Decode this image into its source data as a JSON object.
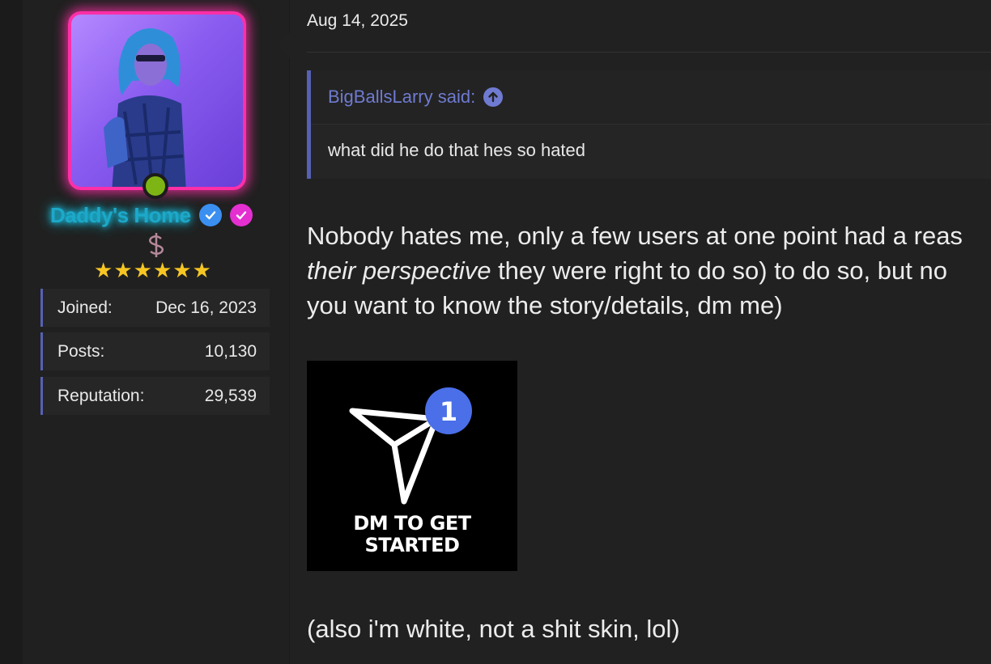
{
  "author": {
    "username": "Daddy's Home",
    "online": true,
    "stars": 6,
    "avatar_alt": "avatar",
    "stats": [
      {
        "label": "Joined:",
        "value": "Dec 16, 2023"
      },
      {
        "label": "Posts:",
        "value": "10,130"
      },
      {
        "label": "Reputation:",
        "value": "29,539"
      }
    ],
    "colors": {
      "username_glow": "#19d7ff",
      "avatar_border": "#ff2fa8",
      "online": "#7db614",
      "stars": "#f7c623"
    }
  },
  "post": {
    "date": "Aug 14, 2025",
    "quote": {
      "author_line": "BigBallsLarry said:",
      "text": "what did he do that hes so hated"
    },
    "message": {
      "line1": "Nobody hates me, only a few users at one point had a reas",
      "line2_italic": "their perspective",
      "line2_rest": " they were right to do so) to do so, but no",
      "line3": "you want to know the story/details, dm me)"
    },
    "image": {
      "badge_number": "1",
      "caption_line1": "DM TO GET",
      "caption_line2": "STARTED"
    },
    "footer": "(also i'm white, not a shit skin, lol)"
  },
  "theme": {
    "accent": "#5661b3",
    "quote_author": "#6f7bd1"
  }
}
